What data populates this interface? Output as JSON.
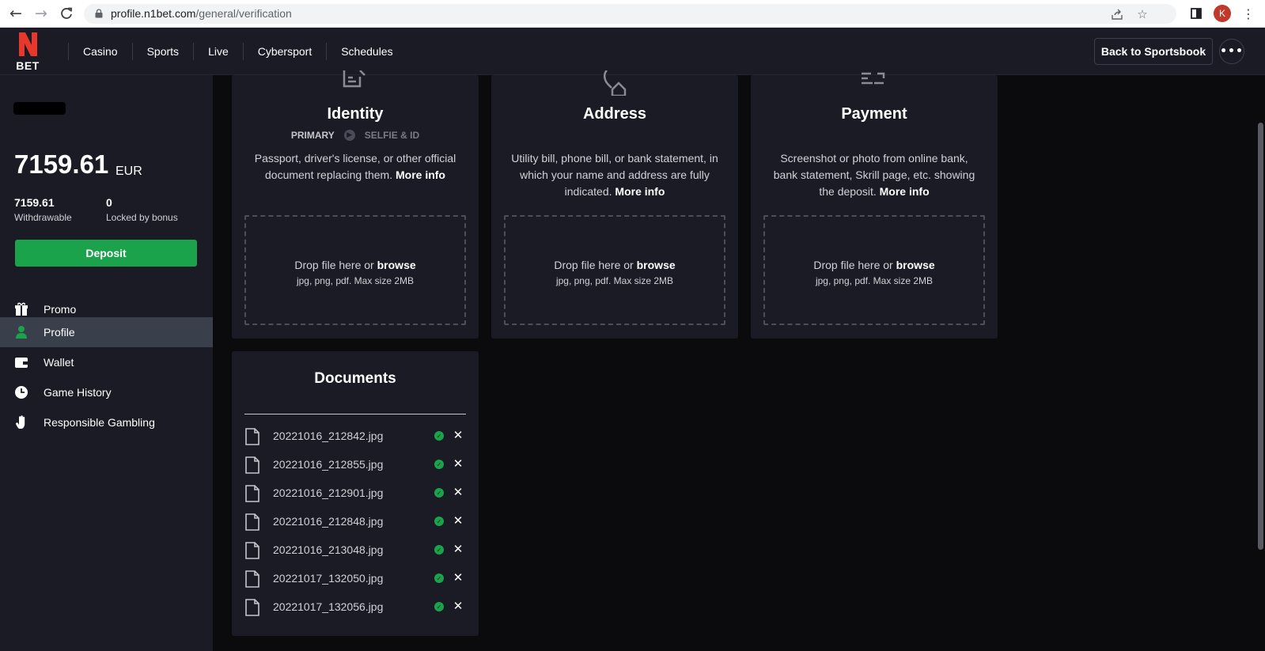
{
  "browser": {
    "url_host": "profile.n1bet.com",
    "url_path": "/general/verification",
    "profile_initial": "K",
    "icons": [
      "back-arrow-icon",
      "forward-arrow-icon",
      "reload-icon",
      "lock-icon",
      "share-icon",
      "star-icon",
      "sidepanel-icon",
      "kebab-menu-icon"
    ]
  },
  "header": {
    "logo_text": "BET",
    "nav": [
      {
        "label": "Casino"
      },
      {
        "label": "Sports"
      },
      {
        "label": "Live"
      },
      {
        "label": "Cybersport"
      },
      {
        "label": "Schedules"
      }
    ],
    "back_button": "Back to Sportsbook",
    "more_button": "•••"
  },
  "sidebar": {
    "balance": "7159.61",
    "currency": "EUR",
    "withdrawable_value": "7159.61",
    "withdrawable_label": "Withdrawable",
    "locked_value": "0",
    "locked_label": "Locked by bonus",
    "deposit_label": "Deposit",
    "menu": [
      {
        "label": "Promo",
        "icon": "gift-icon"
      },
      {
        "label": "Profile",
        "icon": "user-icon",
        "active": true
      },
      {
        "label": "Wallet",
        "icon": "wallet-icon"
      },
      {
        "label": "Game History",
        "icon": "clock-icon"
      },
      {
        "label": "Responsible Gambling",
        "icon": "hand-icon"
      }
    ]
  },
  "cards": {
    "identity": {
      "title": "Identity",
      "step_primary": "PRIMARY",
      "step_secondary": "SELFIE & ID",
      "desc": "Passport, driver's license, or other official document replacing them.",
      "more": "More info",
      "drop_text": "Drop file here or",
      "browse": "browse",
      "drop_sub": "jpg, png, pdf. Max size 2MB"
    },
    "address": {
      "title": "Address",
      "desc": "Utility bill, phone bill, or bank statement, in which your name and address are fully indicated.",
      "more": "More info",
      "drop_text": "Drop file here or",
      "browse": "browse",
      "drop_sub": "jpg, png, pdf. Max size 2MB"
    },
    "payment": {
      "title": "Payment",
      "desc": "Screenshot or photo from online bank, bank statement, Skrill page, etc. showing the deposit.",
      "more": "More info",
      "drop_text": "Drop file here or",
      "browse": "browse",
      "drop_sub": "jpg, png, pdf. Max size 2MB"
    }
  },
  "documents": {
    "title": "Documents",
    "files": [
      "20221016_212842.jpg",
      "20221016_212855.jpg",
      "20221016_212901.jpg",
      "20221016_212848.jpg",
      "20221016_213048.jpg",
      "20221017_132050.jpg",
      "20221017_132056.jpg"
    ]
  },
  "colors": {
    "accent_green": "#1aa34a",
    "logo_red": "#e8382b",
    "panel": "#1a1b24",
    "background": "#0b0b0d"
  }
}
